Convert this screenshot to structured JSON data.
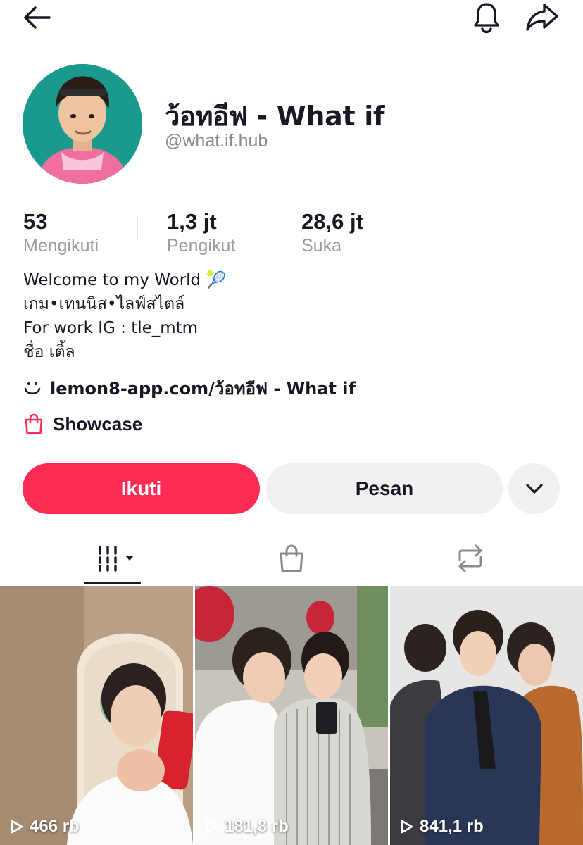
{
  "profile": {
    "display_name": "ว้อทอีฟ - What if",
    "handle": "@what.if.hub"
  },
  "stats": [
    {
      "value": "53",
      "label": "Mengikuti"
    },
    {
      "value": "1,3 jt",
      "label": "Pengikut"
    },
    {
      "value": "28,6 jt",
      "label": "Suka"
    }
  ],
  "bio": {
    "lines": [
      "Welcome to my World 🎾",
      "เกม•เทนนิส•ไลฟ์สไตล์",
      "For work IG : tle_mtm",
      "ชื่อ เติ้ล"
    ]
  },
  "link": {
    "text": "lemon8-app.com/ว้อทอีฟ - What if",
    "icon": "lemon8-smile-icon"
  },
  "showcase": {
    "label": "Showcase",
    "icon": "shopping-bag-icon"
  },
  "actions": {
    "follow_label": "Ikuti",
    "message_label": "Pesan",
    "more_icon": "chevron-down-icon"
  },
  "tabs": [
    {
      "name": "videos",
      "icon": "grid-icon",
      "active": true
    },
    {
      "name": "shop",
      "icon": "shopping-bag-icon",
      "active": false
    },
    {
      "name": "reposts",
      "icon": "repost-icon",
      "active": false
    }
  ],
  "videos": [
    {
      "views": "466 rb"
    },
    {
      "views": "181,8 rb"
    },
    {
      "views": "841,1 rb"
    }
  ],
  "colors": {
    "accent": "#fe2c55",
    "secondary_button": "#f1f1f2",
    "avatar_bg": "#1a9a8c",
    "muted_text": "#9a9ba1"
  }
}
